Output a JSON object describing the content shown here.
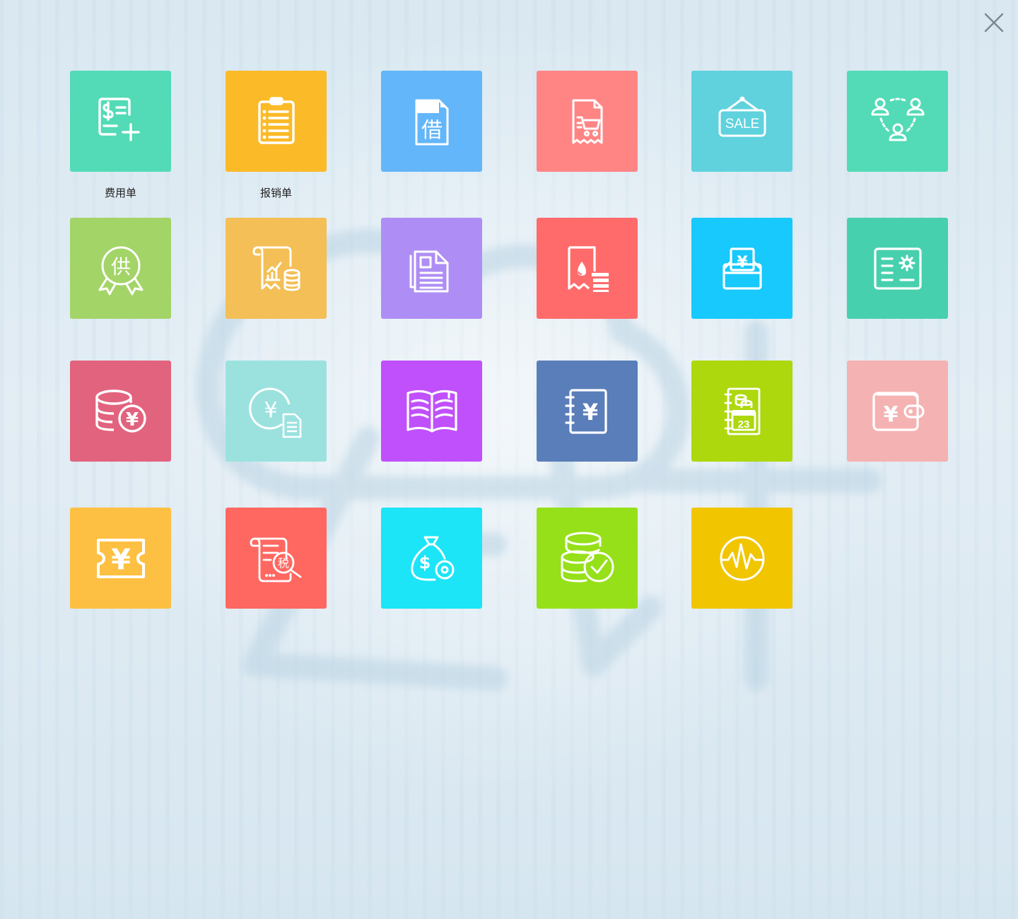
{
  "close": {
    "icon": "close-icon"
  },
  "tiles": [
    {
      "id": "expense-form",
      "label": "费用单",
      "color": "#52dbb6",
      "icon": "dollar-doc-add-icon"
    },
    {
      "id": "reimbursement-form",
      "label": "报销单",
      "color": "#fbba28",
      "icon": "clipboard-list-icon"
    },
    {
      "id": "loan-form",
      "label": "",
      "color": "#63b6f9",
      "icon": "borrow-doc-icon",
      "glyph": "借"
    },
    {
      "id": "purchase-receipt",
      "label": "",
      "color": "#ff8585",
      "icon": "cart-receipt-icon"
    },
    {
      "id": "sales",
      "label": "",
      "color": "#5fd2de",
      "icon": "sale-sign-icon",
      "glyph": "SALE"
    },
    {
      "id": "customers",
      "label": "",
      "color": "#52dbb6",
      "icon": "people-cycle-icon"
    },
    {
      "id": "supplier",
      "label": "",
      "color": "#a3d468",
      "icon": "supplier-badge-icon",
      "glyph": "供"
    },
    {
      "id": "financial-report",
      "label": "",
      "color": "#f3bf56",
      "icon": "report-chart-coins-icon"
    },
    {
      "id": "documents",
      "label": "",
      "color": "#ae8ef4",
      "icon": "documents-icon"
    },
    {
      "id": "fee-receipt",
      "label": "",
      "color": "#ff6b6b",
      "icon": "receipt-coins-icon"
    },
    {
      "id": "cashbox",
      "label": "",
      "color": "#17c9fc",
      "icon": "yuan-box-icon",
      "glyph": "¥"
    },
    {
      "id": "settings-card",
      "label": "",
      "color": "#47d0ae",
      "icon": "settings-card-icon"
    },
    {
      "id": "funds",
      "label": "",
      "color": "#e2637e",
      "icon": "coins-yuan-icon",
      "glyph": "¥"
    },
    {
      "id": "yuan-document",
      "label": "",
      "color": "#9be2df",
      "icon": "yuan-circle-doc-icon",
      "glyph": "¥"
    },
    {
      "id": "ledger-book",
      "label": "",
      "color": "#c050fb",
      "icon": "open-book-icon"
    },
    {
      "id": "account-book",
      "label": "",
      "color": "#5a7eb9",
      "icon": "yuan-notebook-icon",
      "glyph": "¥"
    },
    {
      "id": "payment-calendar",
      "label": "",
      "color": "#add80d",
      "icon": "calendar-coins-icon",
      "glyph": "23"
    },
    {
      "id": "wallet",
      "label": "",
      "color": "#f5b2b2",
      "icon": "yuan-wallet-icon",
      "glyph": "¥"
    },
    {
      "id": "voucher",
      "label": "",
      "color": "#fdc042",
      "icon": "yuan-ticket-icon",
      "glyph": "¥"
    },
    {
      "id": "tax-inquiry",
      "label": "",
      "color": "#ff6861",
      "icon": "tax-search-icon",
      "glyph": "税"
    },
    {
      "id": "fund-settings",
      "label": "",
      "color": "#1be5f6",
      "icon": "money-bag-gear-icon",
      "glyph": "$"
    },
    {
      "id": "fund-check",
      "label": "",
      "color": "#96e019",
      "icon": "coins-check-icon"
    },
    {
      "id": "monitoring",
      "label": "",
      "color": "#f1c500",
      "icon": "pulse-circle-icon"
    }
  ]
}
